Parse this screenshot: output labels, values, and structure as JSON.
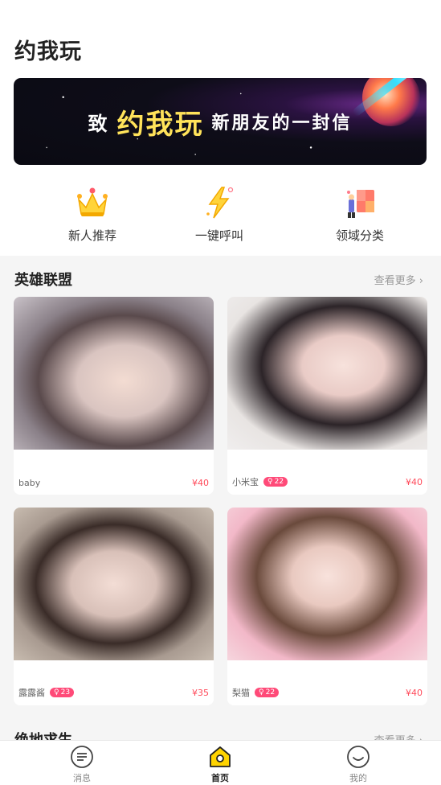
{
  "header": {
    "title": "约我玩"
  },
  "banner": {
    "pre": "致",
    "brand": "约我玩",
    "post": "新朋友的一封信"
  },
  "quick_actions": [
    {
      "label": "新人推荐",
      "icon": "crown-icon"
    },
    {
      "label": "一键呼叫",
      "icon": "lightning-icon"
    },
    {
      "label": "领域分类",
      "icon": "category-icon"
    }
  ],
  "sections": [
    {
      "title": "英雄联盟",
      "see_more": "查看更多 ›",
      "cards": [
        {
          "name": "baby",
          "badge": "",
          "price": "¥40"
        },
        {
          "name": "小米宝",
          "badge": "22",
          "price": "¥40"
        },
        {
          "name": "露露酱",
          "badge": "23",
          "price": "¥35"
        },
        {
          "name": "梨猫",
          "badge": "22",
          "price": "¥40"
        }
      ]
    },
    {
      "title": "绝地求生",
      "see_more": "查看更多 ›"
    }
  ],
  "tabbar": [
    {
      "label": "消息",
      "icon": "message-icon",
      "active": false
    },
    {
      "label": "首页",
      "icon": "home-icon",
      "active": true
    },
    {
      "label": "我的",
      "icon": "profile-icon",
      "active": false
    }
  ],
  "colors": {
    "accent": "#ffd400",
    "price": "#ff4a5a",
    "badge": "#ff4a78",
    "section_bg": "#f5f5f5"
  }
}
